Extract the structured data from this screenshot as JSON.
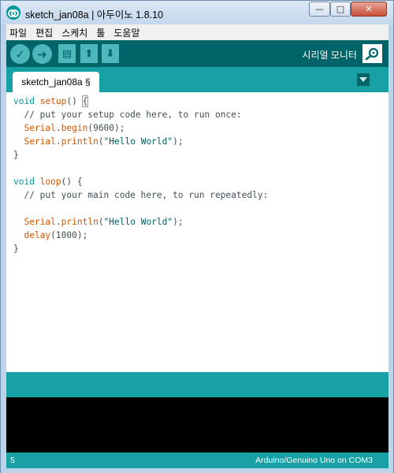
{
  "window": {
    "title": "sketch_jan08a | 아두이노 1.8.10",
    "minimize_glyph": "—",
    "maximize_glyph": "□",
    "close_glyph": "✕"
  },
  "menu": [
    "파일",
    "편집",
    "스케치",
    "툴",
    "도움말"
  ],
  "toolbar": {
    "verify_glyph": "✓",
    "upload_glyph": "➜",
    "new_glyph": "▤",
    "open_glyph": "⬆",
    "save_glyph": "⬇",
    "serial_monitor_label": "시리얼 모니터"
  },
  "tabs": [
    {
      "label": "sketch_jan08a §"
    }
  ],
  "editor": {
    "lines": [
      [
        {
          "t": "void",
          "c": "kw"
        },
        {
          "t": " "
        },
        {
          "t": "setup",
          "c": "fn"
        },
        {
          "t": "() "
        },
        {
          "t": "{",
          "c": "bracket-hl"
        }
      ],
      [
        {
          "t": "  // put your setup code here, to run once:",
          "c": "cm"
        }
      ],
      [
        {
          "t": "  "
        },
        {
          "t": "Serial",
          "c": "fn"
        },
        {
          "t": "."
        },
        {
          "t": "begin",
          "c": "fn"
        },
        {
          "t": "(9600);"
        }
      ],
      [
        {
          "t": "  "
        },
        {
          "t": "Serial",
          "c": "fn"
        },
        {
          "t": "."
        },
        {
          "t": "println",
          "c": "fn"
        },
        {
          "t": "("
        },
        {
          "t": "\"Hello World\"",
          "c": "str"
        },
        {
          "t": ");"
        }
      ],
      [
        {
          "t": "}"
        }
      ],
      [
        {
          "t": ""
        }
      ],
      [
        {
          "t": "void",
          "c": "kw"
        },
        {
          "t": " "
        },
        {
          "t": "loop",
          "c": "fn"
        },
        {
          "t": "() {"
        }
      ],
      [
        {
          "t": "  // put your main code here, to run repeatedly:",
          "c": "cm"
        }
      ],
      [
        {
          "t": ""
        }
      ],
      [
        {
          "t": "  "
        },
        {
          "t": "Serial",
          "c": "fn"
        },
        {
          "t": "."
        },
        {
          "t": "println",
          "c": "fn"
        },
        {
          "t": "("
        },
        {
          "t": "\"Hello World\"",
          "c": "str"
        },
        {
          "t": ");"
        }
      ],
      [
        {
          "t": "  "
        },
        {
          "t": "delay",
          "c": "fn"
        },
        {
          "t": "(1000);"
        }
      ],
      [
        {
          "t": "}"
        }
      ]
    ]
  },
  "status": {
    "line_number": "5",
    "board": "Arduino/Genuino Uno on COM3"
  },
  "colors": {
    "toolbar": "#006468",
    "accent": "#17a1a5",
    "button": "#4db7bb",
    "keyword": "#00979c",
    "function": "#d35400",
    "string": "#005c5f"
  }
}
